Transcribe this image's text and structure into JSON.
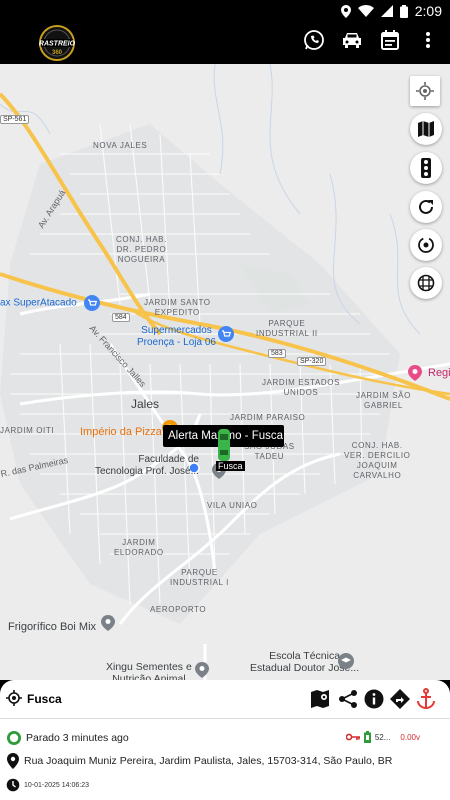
{
  "status_bar": {
    "time": "2:09"
  },
  "app": {
    "logo_text": "RASTREIO 360",
    "actions": [
      "whatsapp-icon",
      "car-icon",
      "calendar-icon",
      "more-vert-icon"
    ]
  },
  "map": {
    "neighborhoods": [
      "NOVA JALES",
      "CONJ. HAB.\nDR. PEDRO\nNOGUEIRA",
      "JARDIM SANTO\nEXPEDITO",
      "PARQUE\nINDUSTRIAL II",
      "JARDIM ESTADOS\nUNIDOS",
      "JARDIM SÃO\nGABRIEL",
      "JARDIM PARAISO",
      "JARDIM OITI",
      "SAO JUDAS\nTADEU",
      "CONJ. HAB.\nVER. DERCILIO\nJOAQUIM\nCARVALHO",
      "VILA UNIAO",
      "JARDIM\nELDORADO",
      "PARQUE\nINDUSTRIAL I",
      "AEROPORTO"
    ],
    "city": "Jales",
    "roads": [
      "SP-561",
      "584",
      "583",
      "SP-320"
    ],
    "road_names": [
      "Av. Arapuá",
      "Av. Francisco Jalles",
      "R. das Palmeiras"
    ],
    "pois": {
      "super_atacado": "ax SuperAtacado",
      "supermercados": "Supermercados\nProença - Loja 06",
      "imperio": "Império da Pizza",
      "faculdade": "Faculdade de\nTecnologia Prof. José...",
      "frigorifico": "Frigorífico Boi Mix",
      "escola": "Escola Técnica\nEstadual Doutor José...",
      "xingu": "Xingu Sementes e\nNutrição Animal",
      "regi": "Regi"
    },
    "alert_text": "Alerta Maximo - Fusca",
    "vehicle_label": "Fusca",
    "buttons": [
      "my-location-icon",
      "map-layers-icon",
      "traffic-icon",
      "refresh-icon",
      "rotate-icon",
      "grid-icon"
    ]
  },
  "panel": {
    "title": "Fusca",
    "status": "Parado 3 minutes ago",
    "battery": "52...",
    "voltage": "0.00v",
    "address": "Rua Joaquim Muniz Pereira, Jardim Paulista, Jales, 15703-314, São Paulo, BR",
    "timestamp": "10-01-2025 14:06:23",
    "colors": {
      "status_green": "#2e9c3a",
      "key_red": "#d32f2f",
      "voltage_red": "#d32f2f",
      "anchor_red": "#e53935"
    }
  }
}
